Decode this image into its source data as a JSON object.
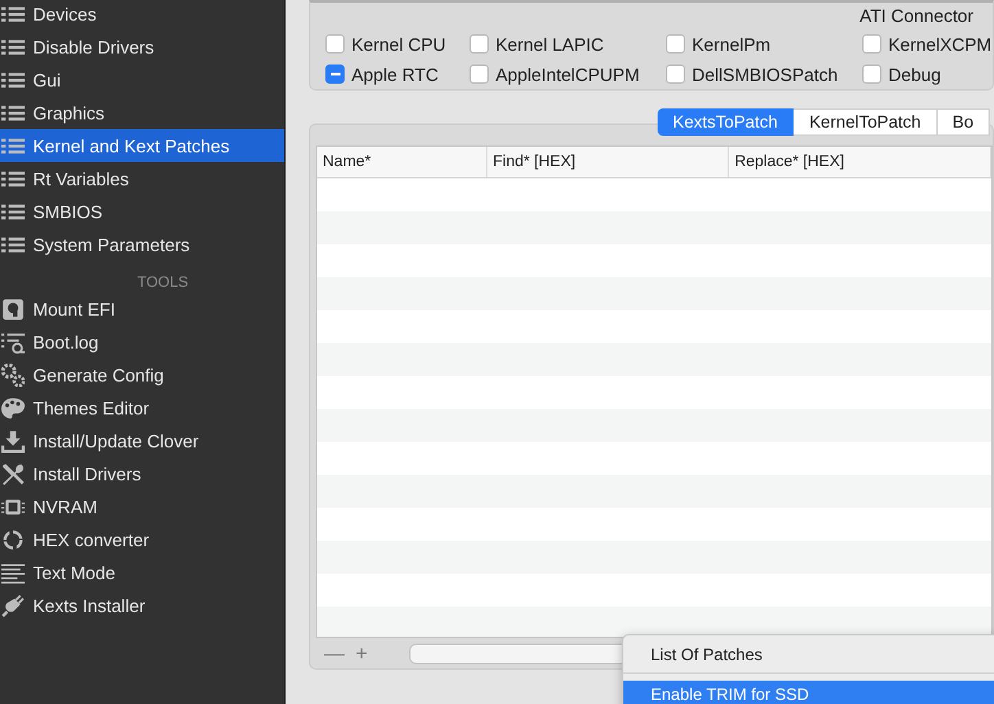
{
  "sidebar": {
    "items": [
      {
        "label": "Devices",
        "selected": false
      },
      {
        "label": "Disable Drivers",
        "selected": false
      },
      {
        "label": "Gui",
        "selected": false
      },
      {
        "label": "Graphics",
        "selected": false
      },
      {
        "label": "Kernel and Kext Patches",
        "selected": true
      },
      {
        "label": "Rt Variables",
        "selected": false
      },
      {
        "label": "SMBIOS",
        "selected": false
      },
      {
        "label": "System Parameters",
        "selected": false
      }
    ],
    "tools_heading": "TOOLS",
    "tools": [
      {
        "label": "Mount EFI",
        "kind": "disk"
      },
      {
        "label": "Boot.log",
        "kind": "log"
      },
      {
        "label": "Generate Config",
        "kind": "gears"
      },
      {
        "label": "Themes Editor",
        "kind": "palette"
      },
      {
        "label": "Install/Update Clover",
        "kind": "download"
      },
      {
        "label": "Install Drivers",
        "kind": "tools"
      },
      {
        "label": "NVRAM",
        "kind": "chip"
      },
      {
        "label": "HEX converter",
        "kind": "cycle"
      },
      {
        "label": "Text Mode",
        "kind": "text"
      },
      {
        "label": "Kexts Installer",
        "kind": "plug"
      }
    ]
  },
  "options": {
    "title": "ATI Connector",
    "checkboxes": [
      {
        "label": "Kernel CPU",
        "checked": false,
        "mixed": false
      },
      {
        "label": "Kernel LAPIC",
        "checked": false,
        "mixed": false
      },
      {
        "label": "KernelPm",
        "checked": false,
        "mixed": false
      },
      {
        "label": "KernelXCPM",
        "checked": false,
        "mixed": false
      },
      {
        "label": "Apple RTC",
        "checked": true,
        "mixed": true
      },
      {
        "label": "AppleIntelCPUPM",
        "checked": false,
        "mixed": false
      },
      {
        "label": "DellSMBIOSPatch",
        "checked": false,
        "mixed": false
      },
      {
        "label": "Debug",
        "checked": false,
        "mixed": false
      }
    ]
  },
  "tabs": [
    {
      "label": "KextsToPatch",
      "selected": true
    },
    {
      "label": "KernelToPatch",
      "selected": false
    },
    {
      "label": "Bo",
      "selected": false
    }
  ],
  "table": {
    "columns": [
      "Name*",
      "Find* [HEX]",
      "Replace* [HEX]"
    ]
  },
  "toolbar": {
    "remove": "—",
    "add": "+"
  },
  "popup_menu": {
    "items": [
      {
        "label": "List Of Patches",
        "selected": false
      },
      {
        "label": "Enable TRIM for SSD",
        "selected": true
      }
    ]
  }
}
